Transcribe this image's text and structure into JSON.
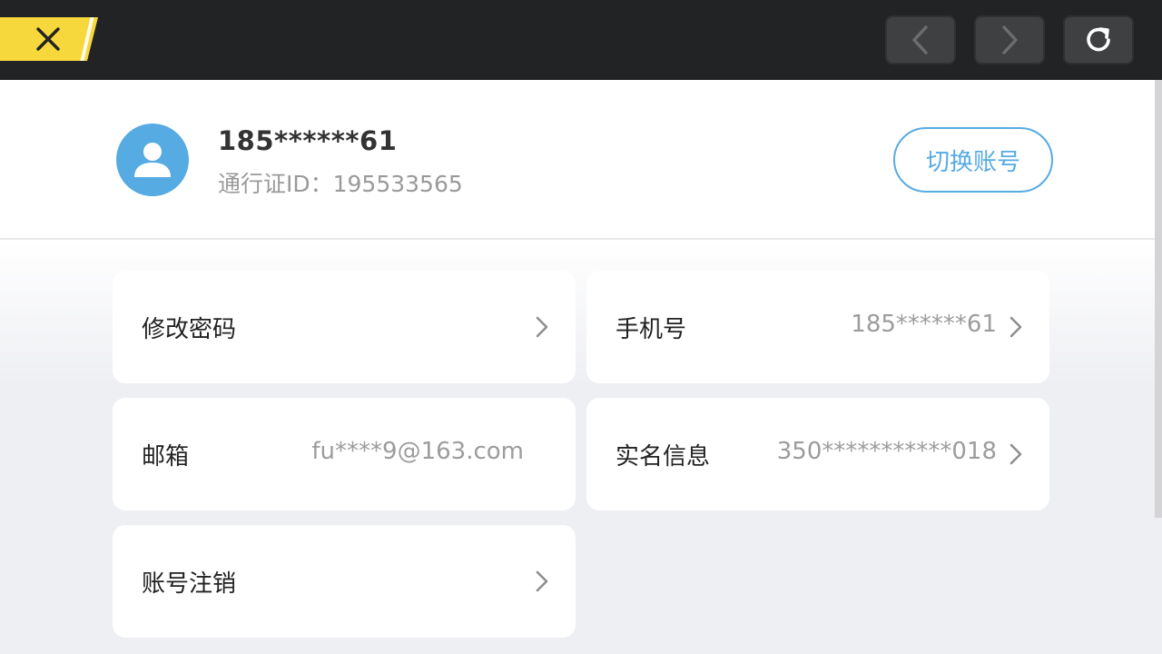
{
  "topbar": {
    "close_icon": "close-icon",
    "back_icon": "chevron-left-icon",
    "forward_icon": "chevron-right-icon",
    "reload_icon": "reload-icon",
    "colors": {
      "bar": "#222325",
      "close_bg": "#f6d83c",
      "button_bg": "#3f4042"
    }
  },
  "account": {
    "avatar_icon": "user-icon",
    "phone": "185******61",
    "pass_id": "通行证ID：195533565",
    "switch_label": "切换账号",
    "accent": "#56abe2"
  },
  "settings": {
    "change_password": {
      "label": "修改密码"
    },
    "phone": {
      "label": "手机号",
      "value": "185******61"
    },
    "email": {
      "label": "邮箱",
      "value": "fu****9@163.com"
    },
    "real_name": {
      "label": "实名信息",
      "value": "350***********018"
    },
    "deactivate": {
      "label": "账号注销"
    }
  }
}
